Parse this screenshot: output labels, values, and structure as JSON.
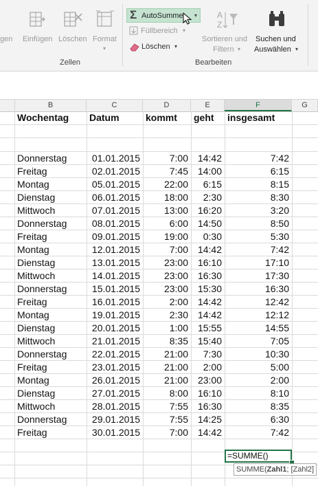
{
  "ribbon": {
    "partial_left": "gen",
    "einfuegen": "Einfügen",
    "loeschen_cells": "Löschen",
    "format": "Format",
    "zellen_group": "Zellen",
    "autosumme": "AutoSumme",
    "fuellbereich": "Füllbereich",
    "loeschen_edit": "Löschen",
    "sortieren_line1": "Sortieren und",
    "sortieren_line2": "Filtern",
    "suchen_line1": "Suchen und",
    "suchen_line2": "Auswählen",
    "bearbeiten_group": "Bearbeiten"
  },
  "columns": [
    "B",
    "C",
    "D",
    "E",
    "F",
    "G"
  ],
  "selected_column": "F",
  "headers": {
    "wochentag": "Wochentag",
    "datum": "Datum",
    "kommt": "kommt",
    "geht": "geht",
    "insgesamt": "insgesamt"
  },
  "rows": [
    {
      "day": "Donnerstag",
      "date": "01.01.2015",
      "kommt": "7:00",
      "geht": "14:42",
      "total": "7:42"
    },
    {
      "day": "Freitag",
      "date": "02.01.2015",
      "kommt": "7:45",
      "geht": "14:00",
      "total": "6:15"
    },
    {
      "day": "Montag",
      "date": "05.01.2015",
      "kommt": "22:00",
      "geht": "6:15",
      "total": "8:15"
    },
    {
      "day": "Dienstag",
      "date": "06.01.2015",
      "kommt": "18:00",
      "geht": "2:30",
      "total": "8:30"
    },
    {
      "day": "Mittwoch",
      "date": "07.01.2015",
      "kommt": "13:00",
      "geht": "16:20",
      "total": "3:20"
    },
    {
      "day": "Donnerstag",
      "date": "08.01.2015",
      "kommt": "6:00",
      "geht": "14:50",
      "total": "8:50"
    },
    {
      "day": "Freitag",
      "date": "09.01.2015",
      "kommt": "19:00",
      "geht": "0:30",
      "total": "5:30"
    },
    {
      "day": "Montag",
      "date": "12.01.2015",
      "kommt": "7:00",
      "geht": "14:42",
      "total": "7:42"
    },
    {
      "day": "Dienstag",
      "date": "13.01.2015",
      "kommt": "23:00",
      "geht": "16:10",
      "total": "17:10"
    },
    {
      "day": "Mittwoch",
      "date": "14.01.2015",
      "kommt": "23:00",
      "geht": "16:30",
      "total": "17:30"
    },
    {
      "day": "Donnerstag",
      "date": "15.01.2015",
      "kommt": "23:00",
      "geht": "15:30",
      "total": "16:30"
    },
    {
      "day": "Freitag",
      "date": "16.01.2015",
      "kommt": "2:00",
      "geht": "14:42",
      "total": "12:42"
    },
    {
      "day": "Montag",
      "date": "19.01.2015",
      "kommt": "2:30",
      "geht": "14:42",
      "total": "12:12"
    },
    {
      "day": "Dienstag",
      "date": "20.01.2015",
      "kommt": "1:00",
      "geht": "15:55",
      "total": "14:55"
    },
    {
      "day": "Mittwoch",
      "date": "21.01.2015",
      "kommt": "8:35",
      "geht": "15:40",
      "total": "7:05"
    },
    {
      "day": "Donnerstag",
      "date": "22.01.2015",
      "kommt": "21:00",
      "geht": "7:30",
      "total": "10:30"
    },
    {
      "day": "Freitag",
      "date": "23.01.2015",
      "kommt": "21:00",
      "geht": "2:00",
      "total": "5:00"
    },
    {
      "day": "Montag",
      "date": "26.01.2015",
      "kommt": "21:00",
      "geht": "23:00",
      "total": "2:00"
    },
    {
      "day": "Dienstag",
      "date": "27.01.2015",
      "kommt": "8:00",
      "geht": "16:10",
      "total": "8:10"
    },
    {
      "day": "Mittwoch",
      "date": "28.01.2015",
      "kommt": "7:55",
      "geht": "16:30",
      "total": "8:35"
    },
    {
      "day": "Donnerstag",
      "date": "29.01.2015",
      "kommt": "7:55",
      "geht": "14:25",
      "total": "6:30"
    },
    {
      "day": "Freitag",
      "date": "30.01.2015",
      "kommt": "7:00",
      "geht": "14:42",
      "total": "7:42"
    }
  ],
  "formula_cell": "=SUMME()",
  "tooltip": {
    "func": "SUMME(",
    "arg1": "Zahl1",
    "rest": "; [Zahl2]"
  },
  "colors": {
    "excel_green": "#217346",
    "autosum_highlight": "#c5e3d0"
  }
}
